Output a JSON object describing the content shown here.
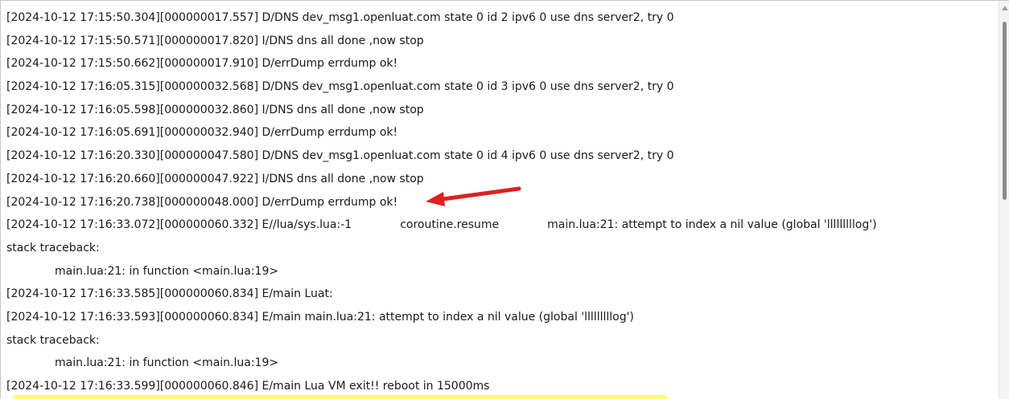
{
  "log": {
    "lines": [
      "[2024-10-12 17:15:50.304][000000017.557] D/DNS dev_msg1.openluat.com state 0 id 2 ipv6 0 use dns server2, try 0",
      "[2024-10-12 17:15:50.571][000000017.820] I/DNS dns all done ,now stop",
      "[2024-10-12 17:15:50.662][000000017.910] D/errDump errdump ok!",
      "[2024-10-12 17:16:05.315][000000032.568] D/DNS dev_msg1.openluat.com state 0 id 3 ipv6 0 use dns server2, try 0",
      "[2024-10-12 17:16:05.598][000000032.860] I/DNS dns all done ,now stop",
      "[2024-10-12 17:16:05.691][000000032.940] D/errDump errdump ok!",
      "[2024-10-12 17:16:20.330][000000047.580] D/DNS dev_msg1.openluat.com state 0 id 4 ipv6 0 use dns server2, try 0",
      "[2024-10-12 17:16:20.660][000000047.922] I/DNS dns all done ,now stop",
      "[2024-10-12 17:16:20.738][000000048.000] D/errDump errdump ok!"
    ],
    "error_line": {
      "prefix": "[2024-10-12 17:16:33.072][000000060.332] E//lua/sys.lua:-1",
      "middle": "coroutine.resume",
      "suffix": "main.lua:21: attempt to index a nil value (global 'lllllllllog')"
    },
    "traceback_1": "stack traceback:",
    "traceback_1_detail": "main.lua:21: in function <main.lua:19>",
    "line_main_luat": "[2024-10-12 17:16:33.585][000000060.834] E/main Luat:",
    "line_main_error": "[2024-10-12 17:16:33.593][000000060.834] E/main main.lua:21: attempt to index a nil value (global 'lllllllllog')",
    "traceback_2": "stack traceback:",
    "traceback_2_detail": "main.lua:21: in function <main.lua:19>",
    "line_vm_exit": "[2024-10-12 17:16:33.599][000000060.846] E/main Lua VM exit!! reboot in 15000ms"
  },
  "colors": {
    "arrow": "#e02020",
    "highlight": "#ffff66",
    "text": "#1a1a1a"
  }
}
